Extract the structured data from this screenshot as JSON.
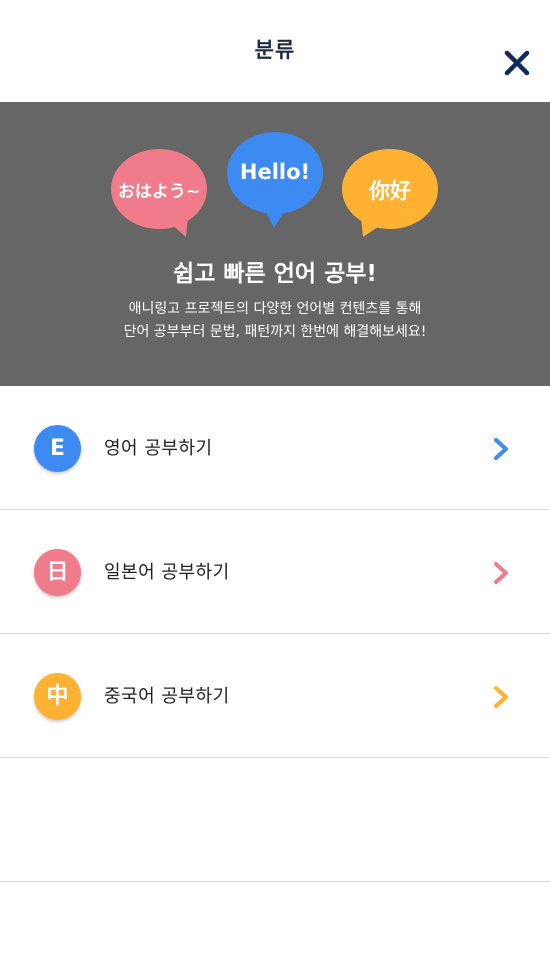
{
  "header": {
    "title": "분류",
    "close_icon": "close-icon"
  },
  "banner": {
    "bubbles": [
      {
        "text": "おはよう~",
        "color": "#f07b8a"
      },
      {
        "text": "Hello!",
        "color": "#3d8bf2"
      },
      {
        "text": "你好",
        "color": "#ffb132"
      }
    ],
    "headline": "쉽고 빠른 언어 공부!",
    "description_line1": "애니링고 프로젝트의 다양한 언어별 컨텐츠를 통해",
    "description_line2": "단어 공부부터 문법, 패턴까지 한번에 해결해보세요!"
  },
  "menu": {
    "items": [
      {
        "badge": "E",
        "label": "영어 공부하기",
        "color": "#3d8bf2"
      },
      {
        "badge": "日",
        "label": "일본어 공부하기",
        "color": "#f07b8a"
      },
      {
        "badge": "中",
        "label": "중국어 공부하기",
        "color": "#ffb132"
      }
    ]
  },
  "colors": {
    "banner_bg": "#666666",
    "title": "#1f2a44",
    "close": "#0f2a5c"
  }
}
